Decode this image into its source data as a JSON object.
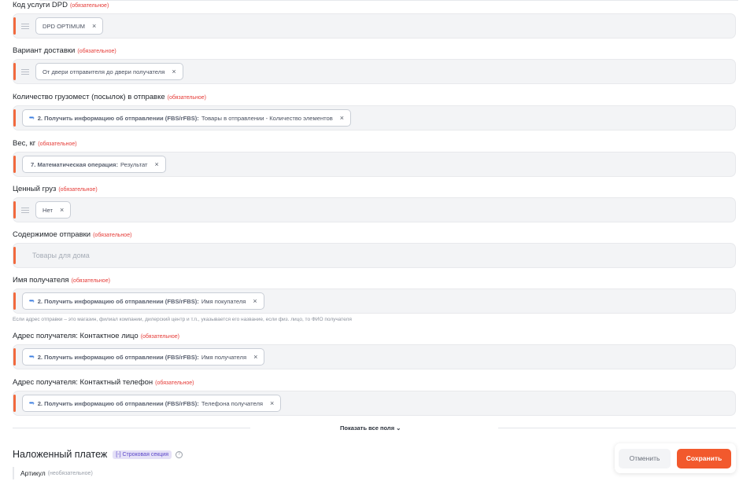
{
  "required_text": "(обязательное)",
  "fields": [
    {
      "label": "Код услуги DPD",
      "chip_text": "DPD OPTIMUM"
    },
    {
      "label": "Вариант доставки",
      "chip_text": "От двери отправителя до двери получателя"
    },
    {
      "label": "Количество грузомест (посылок) в отправке",
      "chip_source": "2. Получить информацию об отправлении (FBS/rFBS):",
      "chip_value": "Товары в отправлении - Количество элементов"
    },
    {
      "label": "Вес, кг",
      "chip_source": "7. Математическая операция:",
      "chip_value": "Результат"
    },
    {
      "label": "Ценный груз",
      "chip_text": "Нет"
    },
    {
      "label": "Содержимое отправки",
      "placeholder": "Товары для дома"
    },
    {
      "label": "Имя получателя",
      "chip_source": "2. Получить информацию об отправлении (FBS/rFBS):",
      "chip_value": "Имя покупателя",
      "hint": "Если адрес отправки – это магазин, филиал компании, дилерский центр и т.п., указывается его название, если физ. лицо, то ФИО получателя"
    },
    {
      "label": "Адрес получателя: Контактное лицо",
      "chip_source": "2. Получить информацию об отправлении (FBS/rFBS):",
      "chip_value": "Имя получателя"
    },
    {
      "label": "Адрес получателя: Контактный телефон",
      "chip_source": "2. Получить информацию об отправлении (FBS/rFBS):",
      "chip_value": "Телефона получателя"
    }
  ],
  "show_all": "Показать все поля",
  "section": {
    "title": "Наложенный платеж",
    "badge": "[-] Строковая секция"
  },
  "subsection": {
    "label": "Артикул",
    "optional": "(необязательное)"
  },
  "actions": {
    "cancel": "Отменить",
    "save": "Сохранить"
  },
  "colors": {
    "accent": "#f26a3e",
    "save_button": "#f2592d",
    "required": "#e53935",
    "variable_icon": "#3b7de0",
    "badge_bg": "#e5e1f7"
  },
  "icons": {
    "list": "list-icon",
    "variable": "variable-icon",
    "remove": "close-icon",
    "help": "help-icon",
    "chevron": "chevron-down-icon"
  }
}
